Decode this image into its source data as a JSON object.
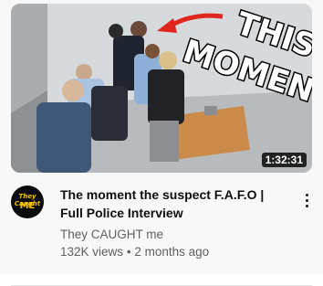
{
  "video": {
    "thumbnail_overlay_text": [
      "THIS",
      "MOMENT"
    ],
    "duration": "1:32:31",
    "title": "The moment the suspect F.A.F.O | Full Police Interview",
    "channel": "They CAUGHT me",
    "views": "132K views",
    "separator": "•",
    "age": "2 months ago"
  },
  "channel_avatar": {
    "line1": "They Caught",
    "line2": "ME",
    "accent_color": "#f5c400"
  },
  "icons": {
    "more": "vertical-ellipsis-icon",
    "arrow": "red-arrow-icon"
  },
  "colors": {
    "title": "#0f0f0f",
    "meta": "#606060",
    "arrow": "#e0261b"
  }
}
